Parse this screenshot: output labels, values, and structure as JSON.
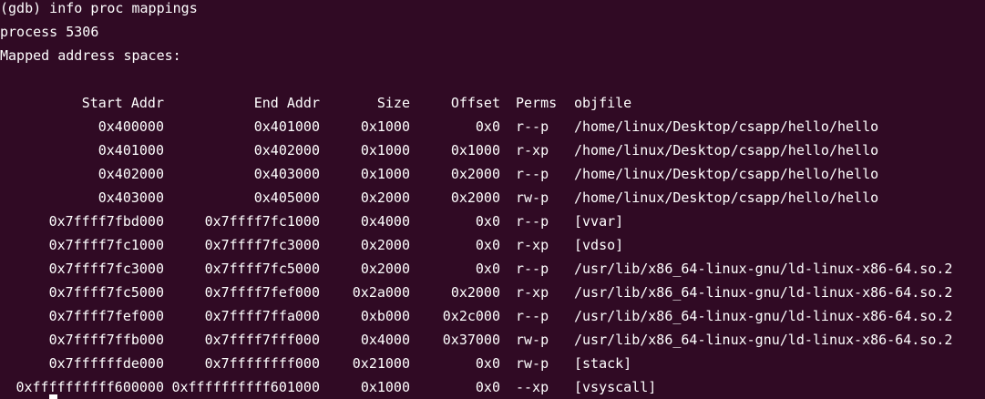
{
  "terminal": {
    "command_line": "(gdb) info proc mappings",
    "process_line": "process 5306",
    "mapped_line": "Mapped address spaces:"
  },
  "table": {
    "headers": {
      "start": "Start Addr",
      "end": "End Addr",
      "size": "Size",
      "offset": "Offset",
      "perms": "Perms",
      "objfile": "objfile"
    },
    "rows": [
      {
        "start": "0x400000",
        "end": "0x401000",
        "size": "0x1000",
        "offset": "0x0",
        "perms": "r--p",
        "objfile": "/home/linux/Desktop/csapp/hello/hello"
      },
      {
        "start": "0x401000",
        "end": "0x402000",
        "size": "0x1000",
        "offset": "0x1000",
        "perms": "r-xp",
        "objfile": "/home/linux/Desktop/csapp/hello/hello"
      },
      {
        "start": "0x402000",
        "end": "0x403000",
        "size": "0x1000",
        "offset": "0x2000",
        "perms": "r--p",
        "objfile": "/home/linux/Desktop/csapp/hello/hello"
      },
      {
        "start": "0x403000",
        "end": "0x405000",
        "size": "0x2000",
        "offset": "0x2000",
        "perms": "rw-p",
        "objfile": "/home/linux/Desktop/csapp/hello/hello"
      },
      {
        "start": "0x7ffff7fbd000",
        "end": "0x7ffff7fc1000",
        "size": "0x4000",
        "offset": "0x0",
        "perms": "r--p",
        "objfile": "[vvar]"
      },
      {
        "start": "0x7ffff7fc1000",
        "end": "0x7ffff7fc3000",
        "size": "0x2000",
        "offset": "0x0",
        "perms": "r-xp",
        "objfile": "[vdso]"
      },
      {
        "start": "0x7ffff7fc3000",
        "end": "0x7ffff7fc5000",
        "size": "0x2000",
        "offset": "0x0",
        "perms": "r--p",
        "objfile": "/usr/lib/x86_64-linux-gnu/ld-linux-x86-64.so.2"
      },
      {
        "start": "0x7ffff7fc5000",
        "end": "0x7ffff7fef000",
        "size": "0x2a000",
        "offset": "0x2000",
        "perms": "r-xp",
        "objfile": "/usr/lib/x86_64-linux-gnu/ld-linux-x86-64.so.2"
      },
      {
        "start": "0x7ffff7fef000",
        "end": "0x7ffff7ffa000",
        "size": "0xb000",
        "offset": "0x2c000",
        "perms": "r--p",
        "objfile": "/usr/lib/x86_64-linux-gnu/ld-linux-x86-64.so.2"
      },
      {
        "start": "0x7ffff7ffb000",
        "end": "0x7ffff7fff000",
        "size": "0x4000",
        "offset": "0x37000",
        "perms": "rw-p",
        "objfile": "/usr/lib/x86_64-linux-gnu/ld-linux-x86-64.so.2"
      },
      {
        "start": "0x7ffffffde000",
        "end": "0x7ffffffff000",
        "size": "0x21000",
        "offset": "0x0",
        "perms": "rw-p",
        "objfile": "[stack]"
      },
      {
        "start": "0xffffffffff600000",
        "end": "0xffffffffff601000",
        "size": "0x1000",
        "offset": "0x0",
        "perms": "--xp",
        "objfile": "[vsyscall]"
      }
    ]
  },
  "colors": {
    "background": "#300a24",
    "foreground": "#ffffff"
  }
}
